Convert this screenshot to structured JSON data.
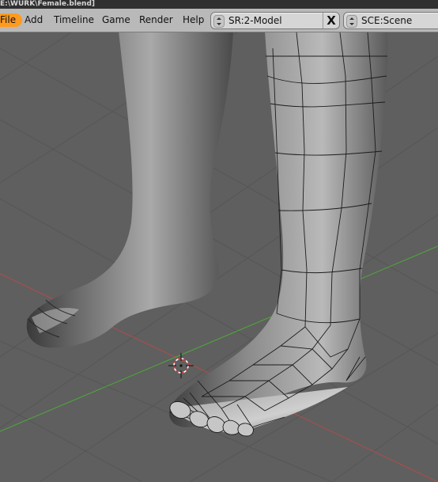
{
  "window": {
    "title": "E:\\WURK\\Female.blend]"
  },
  "menubar": {
    "items": [
      "File",
      "Add",
      "Timeline",
      "Game",
      "Render",
      "Help"
    ]
  },
  "screen_selector": {
    "value": "SR:2-Model",
    "close_label": "X"
  },
  "scene_selector": {
    "value": "SCE:Scene"
  },
  "viewport": {
    "background": "#5f5f5f",
    "grid_color": "#565656",
    "x_axis_color": "#b34b4b",
    "y_axis_color": "#4caa38",
    "cursor": "3d-cursor-icon"
  },
  "colors": {
    "menubar": "#b9b9b9",
    "file_menu_active": "#ff9a1f"
  }
}
